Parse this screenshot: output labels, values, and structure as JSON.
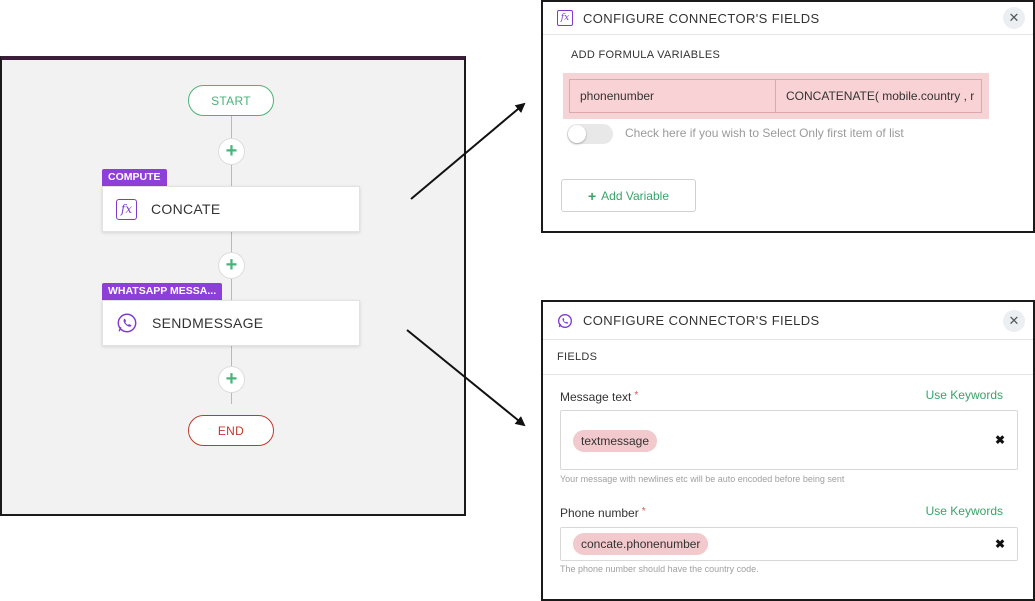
{
  "flow": {
    "start_label": "START",
    "end_label": "END",
    "add_symbol": "+",
    "nodes": [
      {
        "tag": "COMPUTE",
        "label": "CONCATE",
        "icon": "fx-icon",
        "icon_text": "fx"
      },
      {
        "tag": "WHATSAPP MESSA...",
        "label": "SENDMESSAGE",
        "icon": "whatsapp-icon"
      }
    ],
    "colors": {
      "start": "#49b37a",
      "end": "#c0392b",
      "tag": "#8e3fd7"
    }
  },
  "panel_formula": {
    "title": "CONFIGURE CONNECTOR'S FIELDS",
    "icon": "fx-icon",
    "icon_text": "fx",
    "close_symbol": "✕",
    "section_label": "ADD FORMULA VARIABLES",
    "variable": {
      "name": "phonenumber",
      "formula": "CONCATENATE( mobile.country , r"
    },
    "toggle_label": "Check here if you wish to Select Only first item of list",
    "add_button": "Add Variable",
    "add_symbol": "+"
  },
  "panel_whatsapp": {
    "title": "CONFIGURE CONNECTOR'S FIELDS",
    "icon": "whatsapp-icon",
    "close_symbol": "✕",
    "section_label": "FIELDS",
    "required_mark": "*",
    "keywords_link": "Use Keywords",
    "clear_symbol": "✖",
    "fields": [
      {
        "label": "Message text",
        "value": "textmessage",
        "hint": "Your message with newlines etc will be auto encoded before being sent"
      },
      {
        "label": "Phone number",
        "value": "concate.phonenumber",
        "hint": "The phone number should have the country code."
      }
    ]
  }
}
